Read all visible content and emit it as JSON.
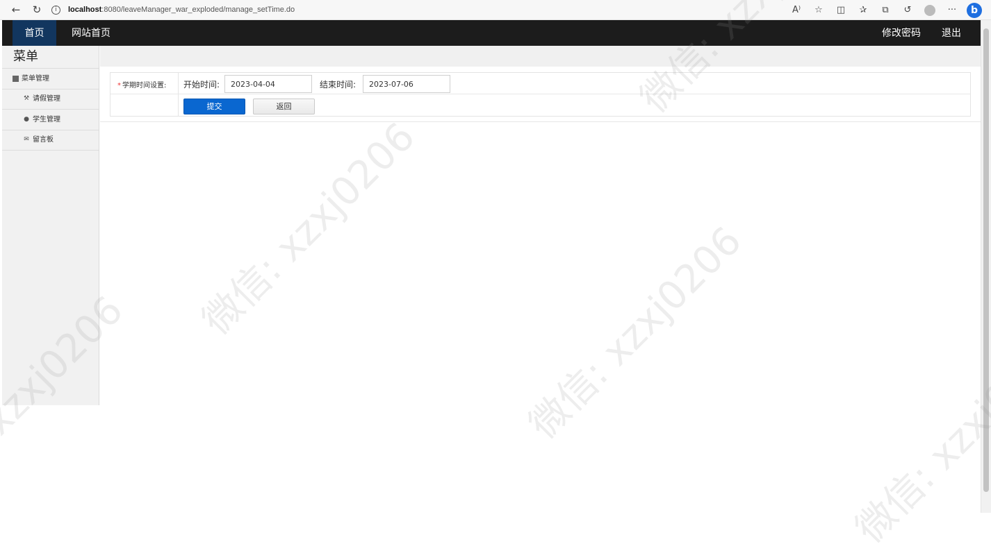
{
  "browser": {
    "url_host": "localhost",
    "url_rest": ":8080/leaveManager_war_exploded/manage_setTime.do",
    "read_aloud_label": "A⁾"
  },
  "header": {
    "home": "首页",
    "site_home": "网站首页",
    "change_password": "修改密码",
    "logout": "退出"
  },
  "sidebar": {
    "title": "菜单",
    "group_label": "菜单管理",
    "items": [
      {
        "label": "请假管理",
        "icon": "wrench-icon"
      },
      {
        "label": "学生管理",
        "icon": "comment-icon"
      },
      {
        "label": "留言板",
        "icon": "envelope-icon"
      }
    ]
  },
  "form": {
    "required_mark": "*",
    "field_label": "学期时间设置:",
    "start_label": "开始时间:",
    "start_value": "2023-04-04",
    "end_label": "结束时间:",
    "end_value": "2023-07-06",
    "submit": "提交",
    "back": "返回"
  },
  "watermark": "微信: xzxj0206",
  "colors": {
    "header_bg": "#1c1c1c",
    "home_active_bg": "#12365f",
    "submit_bg": "#0a67d0",
    "sidebar_bg": "#f1f1f1"
  }
}
